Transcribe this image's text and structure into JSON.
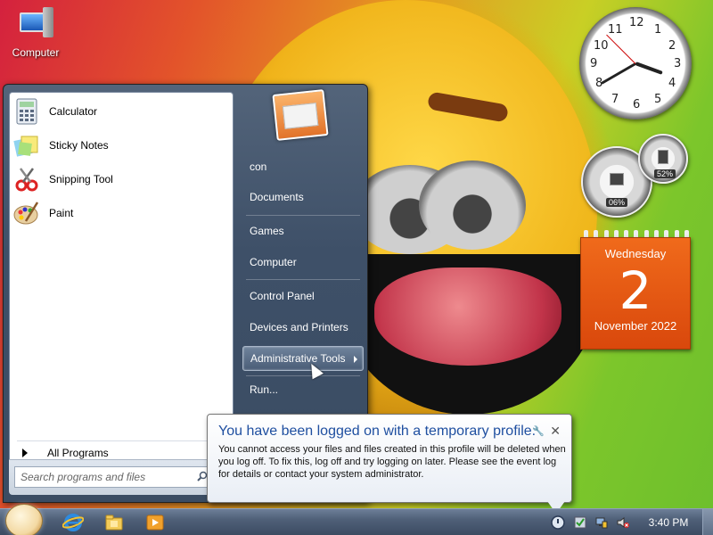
{
  "desktop": {
    "icons": [
      {
        "label": "Computer"
      }
    ]
  },
  "start_menu": {
    "programs": [
      {
        "label": "Calculator",
        "icon": "calculator-icon"
      },
      {
        "label": "Sticky Notes",
        "icon": "sticky-notes-icon"
      },
      {
        "label": "Snipping Tool",
        "icon": "snipping-tool-icon"
      },
      {
        "label": "Paint",
        "icon": "paint-icon"
      }
    ],
    "all_programs": "All Programs",
    "search_placeholder": "Search programs and files",
    "right_items": [
      {
        "label": "con"
      },
      {
        "label": "Documents"
      },
      {
        "label": "Games"
      },
      {
        "label": "Computer"
      },
      {
        "label": "Control Panel"
      },
      {
        "label": "Devices and Printers"
      },
      {
        "label": "Administrative Tools",
        "highlighted": true
      },
      {
        "label": "Run..."
      }
    ]
  },
  "gadgets": {
    "clock": {
      "numbers": [
        "12",
        "1",
        "2",
        "3",
        "4",
        "5",
        "6",
        "7",
        "8",
        "9",
        "10",
        "11"
      ],
      "time": "3:40"
    },
    "cpu_meter": {
      "cpu_percent": "06%",
      "memory_percent": "52%"
    },
    "calendar": {
      "weekday": "Wednesday",
      "day": "2",
      "month_year": "November 2022"
    }
  },
  "notification": {
    "title": "You have been logged on with a temporary profile.",
    "body": "You cannot access your files and files created in this profile will be deleted when you log off. To fix this, log off and try logging on later. Please see the event log for details or contact your system administrator."
  },
  "taskbar": {
    "pinned": [
      "internet-explorer-icon",
      "windows-explorer-icon",
      "media-player-icon"
    ],
    "tray": [
      "action-center-icon",
      "security-icon",
      "network-icon",
      "volume-muted-icon"
    ],
    "time": "3:40 PM"
  }
}
